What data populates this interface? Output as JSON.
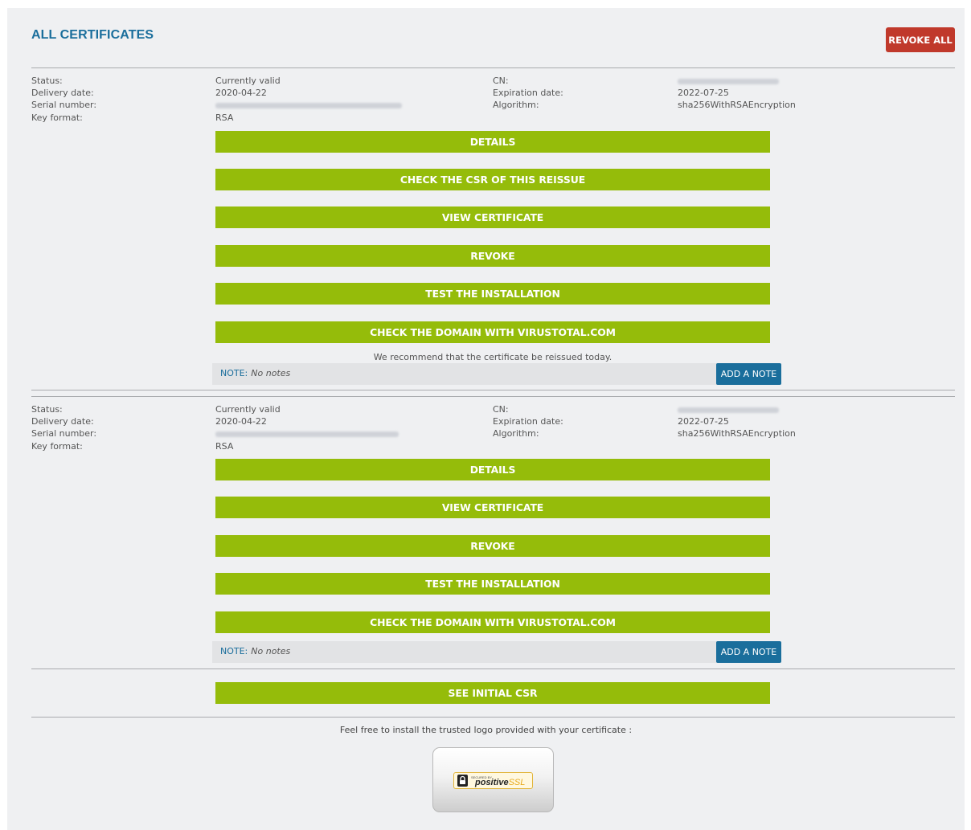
{
  "header": {
    "title": "ALL CERTIFICATES",
    "revoke_all_label": "REVOKE ALL"
  },
  "labels": {
    "status": "Status:",
    "delivery_date": "Delivery date:",
    "serial_number": "Serial number:",
    "key_format": "Key format:",
    "cn": "CN:",
    "expiration_date": "Expiration date:",
    "algorithm": "Algorithm:",
    "note": "NOTE:",
    "add_note": "ADD A NOTE"
  },
  "certificates": [
    {
      "status": "Currently valid",
      "delivery_date": "2020-04-22",
      "key_format": "RSA",
      "expiration_date": "2022-07-25",
      "algorithm": "sha256WithRSAEncryption",
      "buttons": [
        "DETAILS",
        "CHECK THE CSR OF THIS REISSUE",
        "VIEW CERTIFICATE",
        "REVOKE",
        "TEST THE INSTALLATION",
        "CHECK THE DOMAIN WITH VIRUSTOTAL.COM"
      ],
      "recommendation": "We recommend that the certificate be reissued today.",
      "note": "No notes"
    },
    {
      "status": "Currently valid",
      "delivery_date": "2020-04-22",
      "key_format": "RSA",
      "expiration_date": "2022-07-25",
      "algorithm": "sha256WithRSAEncryption",
      "buttons": [
        "DETAILS",
        "VIEW CERTIFICATE",
        "REVOKE",
        "TEST THE INSTALLATION",
        "CHECK THE DOMAIN WITH VIRUSTOTAL.COM"
      ],
      "note": "No notes"
    }
  ],
  "initial_csr_label": "SEE INITIAL CSR",
  "footer": {
    "text": "Feel free to install the trusted logo provided with your certificate :"
  },
  "logo": {
    "secured_by": "SECURED BY",
    "brand": "positive",
    "brand_suffix": "SSL"
  }
}
